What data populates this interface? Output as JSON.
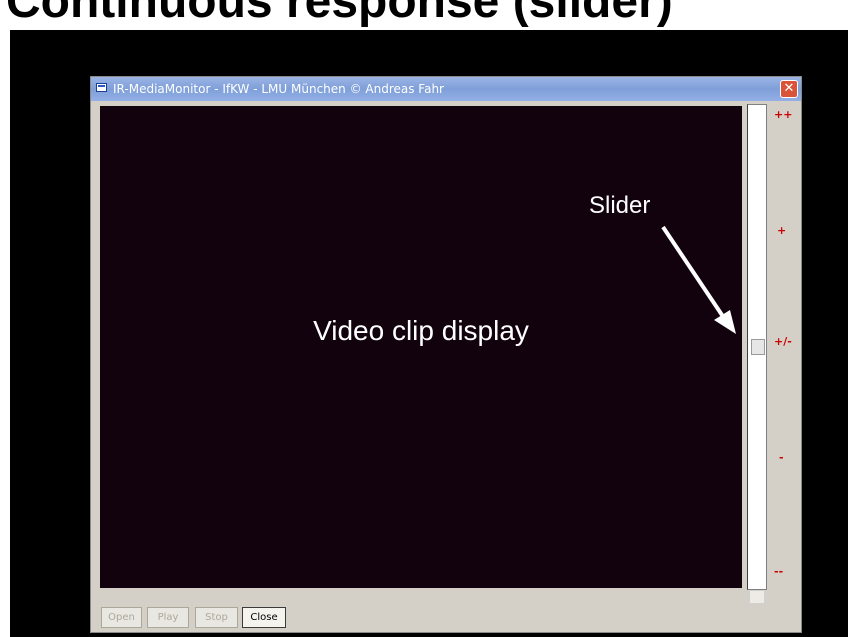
{
  "slide": {
    "title": "Continuous response (slider)"
  },
  "window": {
    "title": "IR-MediaMonitor - IfKW - LMU München © Andreas Fahr",
    "close_glyph": "✕"
  },
  "video": {
    "label": "Video clip display"
  },
  "annotation": {
    "slider_label": "Slider"
  },
  "slider": {
    "value_fraction": 0.5,
    "scale": [
      "++",
      "+",
      "+/-",
      "-",
      "--"
    ]
  },
  "buttons": [
    {
      "label": "Open",
      "enabled": false
    },
    {
      "label": "Play",
      "enabled": false
    },
    {
      "label": "Stop",
      "enabled": false
    },
    {
      "label": "Close",
      "enabled": true
    }
  ],
  "colors": {
    "video_bg": "#12020e",
    "scale_text": "#cc0000",
    "stage_bg": "#000000"
  },
  "icons": [
    "window-app-icon",
    "close-icon",
    "annotation-arrow-icon"
  ]
}
